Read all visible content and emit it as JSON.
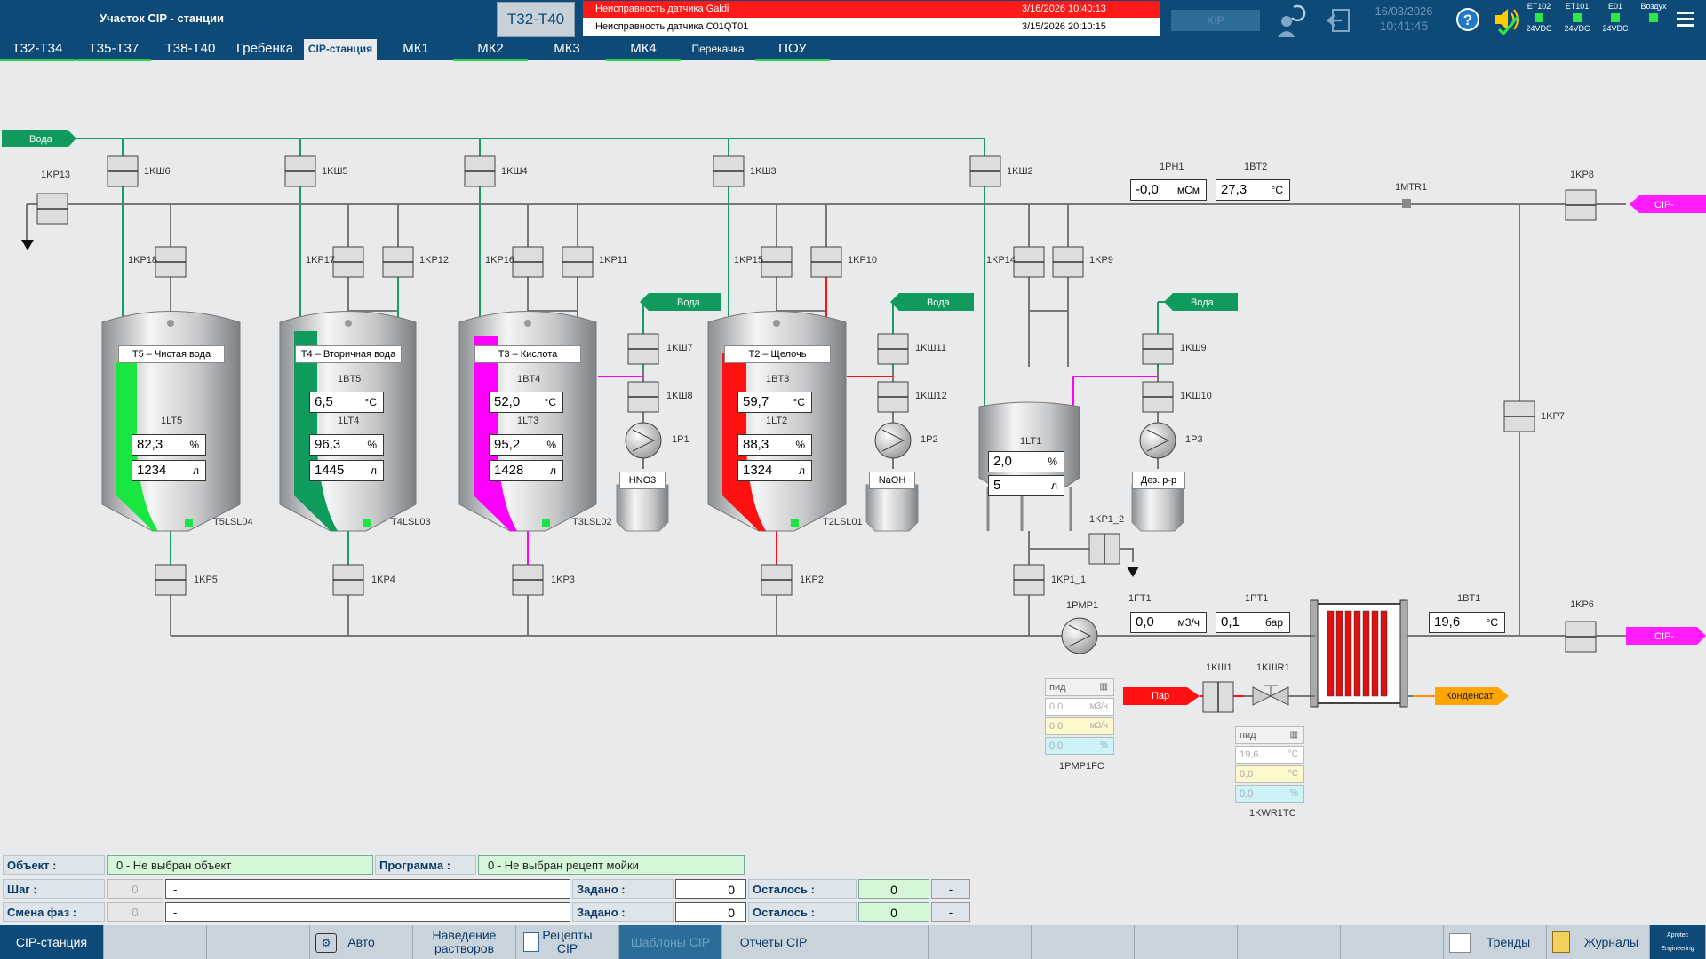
{
  "header": {
    "title": "Участок CIP - станции",
    "area_button": "Т32-Т40",
    "alarms": [
      {
        "text": "Неисправность датчика Galdi",
        "time": "3/16/2026 10:40:13"
      },
      {
        "text": "Неисправность датчика C01QT01",
        "time": "3/15/2026 20:10:15"
      }
    ],
    "kip_button": "KIP",
    "date": "16/03/2026",
    "time": "10:41:45",
    "indicators": [
      {
        "name": "ET102",
        "sub": "24VDC"
      },
      {
        "name": "ET101",
        "sub": "24VDC"
      },
      {
        "name": "E01",
        "sub": "24VDC"
      },
      {
        "name": "Воздух",
        "sub": ""
      }
    ]
  },
  "tabs": [
    "Т32-Т34",
    "Т35-Т37",
    "Т38-Т40",
    "Гребенка",
    "CIP-станция",
    "МК1",
    "МК2",
    "МК3",
    "МК4",
    "Перекачка",
    "ПОУ"
  ],
  "colors": {
    "primary": "#0d4a78",
    "water": "#1a9b63",
    "acid": "#ff00ff",
    "alkali": "#ff1111",
    "clean": "#19e640",
    "secondary": "#0e9b5c"
  },
  "diagram": {
    "inlets": {
      "water": "Вода",
      "cip_return": "CIP-",
      "cip_out": "CIP-",
      "steam": "Пар",
      "condensate": "Конденсат"
    },
    "valves": {
      "v1KP13": "1KP13",
      "v1KW6": "1KШ6",
      "v1KW5": "1KШ5",
      "v1KW4": "1KШ4",
      "v1KW3": "1KШ3",
      "v1KW2": "1KШ2",
      "v1KP18": "1KP18",
      "v1KP17": "1KP17",
      "v1KP12": "1KP12",
      "v1KP16": "1KP16",
      "v1KP11": "1KP11",
      "v1KP15": "1KP15",
      "v1KP10": "1KP10",
      "v1KP14": "1KP14",
      "v1KP9": "1KP9",
      "v1KP8": "1KP8",
      "v1KP7": "1KP7",
      "v1KW7": "1KШ7",
      "v1KW8": "1KШ8",
      "v1KW11": "1KШ11",
      "v1KW12": "1KШ12",
      "v1KW9": "1KШ9",
      "v1KW10": "1KШ10",
      "v1KP5": "1KP5",
      "v1KP4": "1KP4",
      "v1KP3": "1KP3",
      "v1KP2": "1KP2",
      "v1KP1_1": "1KP1_1",
      "v1KP1_2": "1KP1_2",
      "v1KP6": "1KP6",
      "v1KW1": "1KШ1",
      "v1KWR1": "1KШR1"
    },
    "pumps": {
      "p1P1": "1P1",
      "p1P2": "1P2",
      "p1P3": "1P3",
      "p1PMP1": "1PMP1"
    },
    "sensors": {
      "ph1": {
        "tag": "1PH1",
        "value": "-0,0",
        "unit": "мСм"
      },
      "bt2": {
        "tag": "1BT2",
        "value": "27,3",
        "unit": "°C"
      },
      "mtr1": {
        "tag": "1MTR1"
      },
      "ft1": {
        "tag": "1FT1",
        "value": "0,0",
        "unit": "м3/ч"
      },
      "pt1": {
        "tag": "1PT1",
        "value": "0,1",
        "unit": "бар"
      },
      "bt1": {
        "tag": "1BT1",
        "value": "19,6",
        "unit": "°C"
      }
    },
    "tanks": [
      {
        "label": "Т5 – Чистая вода",
        "temp_tag": "",
        "temp": "",
        "level_tag": "1LT5",
        "level_pct": "82,3",
        "volume": "1234",
        "lsl": "T5LSL04",
        "color": "#19e640",
        "level": 0.823
      },
      {
        "label": "Т4 – Вторичная вода",
        "temp_tag": "1BT5",
        "temp": "6,5",
        "level_tag": "1LT4",
        "level_pct": "96,3",
        "volume": "1445",
        "lsl": "T4LSL03",
        "color": "#0e9b5c",
        "level": 0.963
      },
      {
        "label": "Т3 – Кислота",
        "temp_tag": "1BT4",
        "temp": "52,0",
        "level_tag": "1LT3",
        "level_pct": "95,2",
        "volume": "1428",
        "lsl": "T3LSL02",
        "color": "#ff00ff",
        "level": 0.952
      },
      {
        "label": "Т2 – Щелочь",
        "temp_tag": "1BT3",
        "temp": "59,7",
        "level_tag": "1LT2",
        "level_pct": "88,3",
        "volume": "1324",
        "lsl": "T2LSL01",
        "color": "#ff1111",
        "level": 0.883
      }
    ],
    "units": {
      "pct": "%",
      "liter": "л",
      "degc": "°C"
    },
    "small_tank": {
      "level_tag": "1LT1",
      "level_pct": "2,0",
      "volume": "5"
    },
    "dosing": {
      "hno3": "HNO3",
      "naoh": "NaOH",
      "dez": "Дез. р-р"
    },
    "pid_pmp": {
      "tag": "1PMP1FC",
      "title": "пид",
      "rows": [
        {
          "value": "0,0",
          "unit": "м3/ч"
        },
        {
          "value": "0,0",
          "unit": "м3/ч"
        },
        {
          "value": "0,0",
          "unit": "%"
        }
      ]
    },
    "pid_kwr": {
      "tag": "1KWR1TC",
      "title": "пид",
      "rows": [
        {
          "value": "19,6",
          "unit": "°C"
        },
        {
          "value": "0,0",
          "unit": "°C"
        },
        {
          "value": "0,0",
          "unit": "%"
        }
      ]
    }
  },
  "info": {
    "object_label": "Объект :",
    "object_value": "0 - Не выбран объект",
    "program_label": "Программа :",
    "program_value": "0 - Не выбран рецепт мойки",
    "step_label": "Шаг :",
    "step_num": "0",
    "step_text": "-",
    "step_set_label": "Задано :",
    "step_set": "0",
    "step_left_label": "Осталось :",
    "step_left": "0",
    "step_btn": "-",
    "phase_label": "Смена фаз :",
    "phase_num": "0",
    "phase_text": "-",
    "phase_set_label": "Задано :",
    "phase_set": "0",
    "phase_left_label": "Осталось :",
    "phase_left": "0",
    "phase_btn": "-"
  },
  "nav": {
    "cip_station": "CIP-станция",
    "auto": "Авто",
    "solutions": "Наведение растворов",
    "recipes": "Рецепты CIP",
    "templates": "Шаблоны CIP",
    "reports": "Отчеты CIP",
    "trends": "Тренды",
    "journals": "Журналы",
    "logo": "Aprotec Engineering"
  }
}
